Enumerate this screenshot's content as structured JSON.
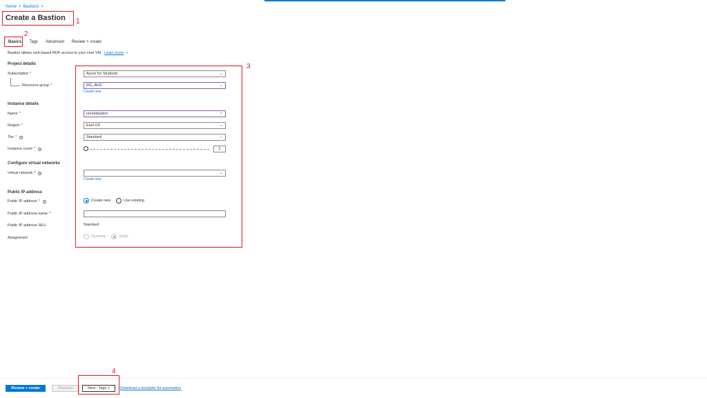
{
  "breadcrumb": {
    "home": "Home",
    "bastions": "Bastions",
    "sep": ">"
  },
  "header": {
    "title": "Create a Bastion",
    "more": "···"
  },
  "tabs": [
    {
      "label": "Basics",
      "active": true
    },
    {
      "label": "Tags"
    },
    {
      "label": "Advanced"
    },
    {
      "label": "Review + create"
    }
  ],
  "intro": {
    "text": "Bastion allows web based RDP access to your vnet VM.",
    "link": "Learn more"
  },
  "project": {
    "heading": "Project details",
    "subscription_label": "Subscription",
    "subscription_value": "Azure for Students",
    "resource_group_label": "Resource group",
    "resource_group_value": "RG_AKD",
    "create_new": "Create new"
  },
  "instance": {
    "heading": "Instance details",
    "name_label": "Name",
    "name_value": "omekbastion",
    "region_label": "Region",
    "region_value": "East US",
    "tier_label": "Tier",
    "tier_value": "Standard",
    "count_label": "Instance count",
    "count_value": "2"
  },
  "vnet": {
    "heading": "Configure virtual networks",
    "label": "Virtual network",
    "value": "",
    "create_new": "Create new"
  },
  "publicip": {
    "heading": "Public IP address",
    "label": "Public IP address",
    "option_new": "Create new",
    "option_existing": "Use existing",
    "name_label": "Public IP address name",
    "name_value": "",
    "sku_label": "Public IP address SKU",
    "sku_value": "Standard",
    "assignment_label": "Assignment",
    "assignment_dynamic": "Dynamic",
    "assignment_static": "Static"
  },
  "footer": {
    "review_create": "Review + create",
    "previous": "Previous",
    "next": "Next : Tags >",
    "download": "Download a template for automation"
  },
  "callouts": [
    "1",
    "2",
    "3",
    "4"
  ],
  "colors": {
    "accent": "#0078d4",
    "callout": "#e81123",
    "required": "#a4262c"
  }
}
